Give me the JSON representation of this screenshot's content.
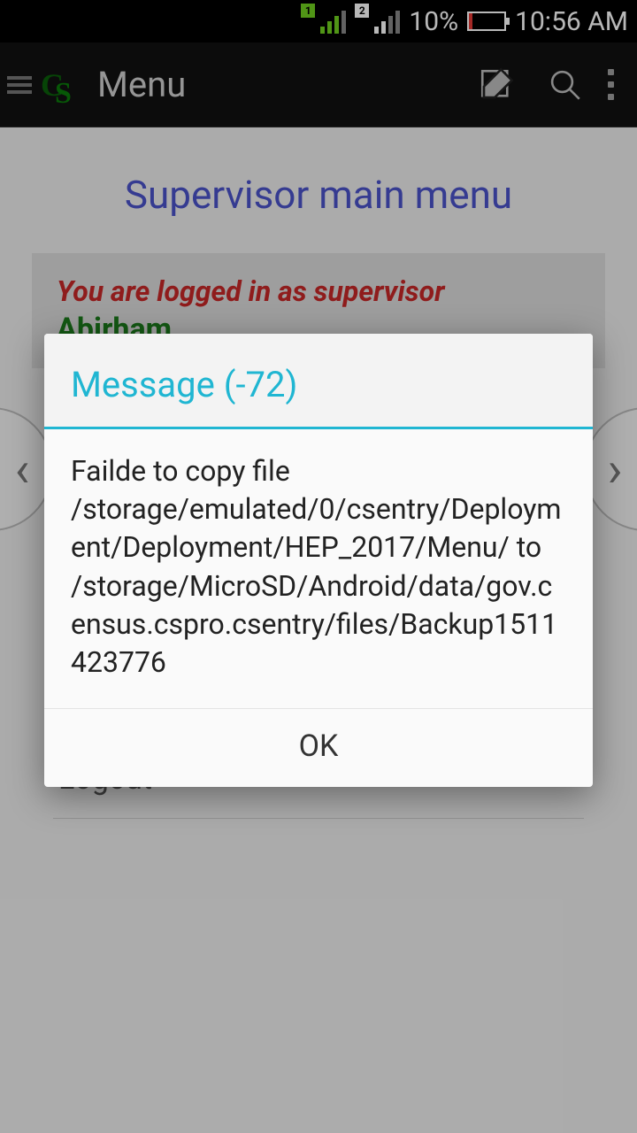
{
  "status": {
    "battery_pct": "10%",
    "time": "10:56 AM",
    "sim1": "1",
    "sim2": "2"
  },
  "app_bar": {
    "title": "Menu"
  },
  "page": {
    "title": "Supervisor main menu",
    "login_msg": "You are logged in as supervisor",
    "username": "Abirham"
  },
  "menu": {
    "logout": "Logout"
  },
  "dialog": {
    "title": "Message (-72)",
    "body": "Failde to copy file /storage/emulated/0/csentry/Deployment/Deployment/HEP_2017/Menu/ to /storage/MicroSD/Android/data/gov.census.cspro.csentry/files/Backup1511423776",
    "ok": "OK"
  }
}
